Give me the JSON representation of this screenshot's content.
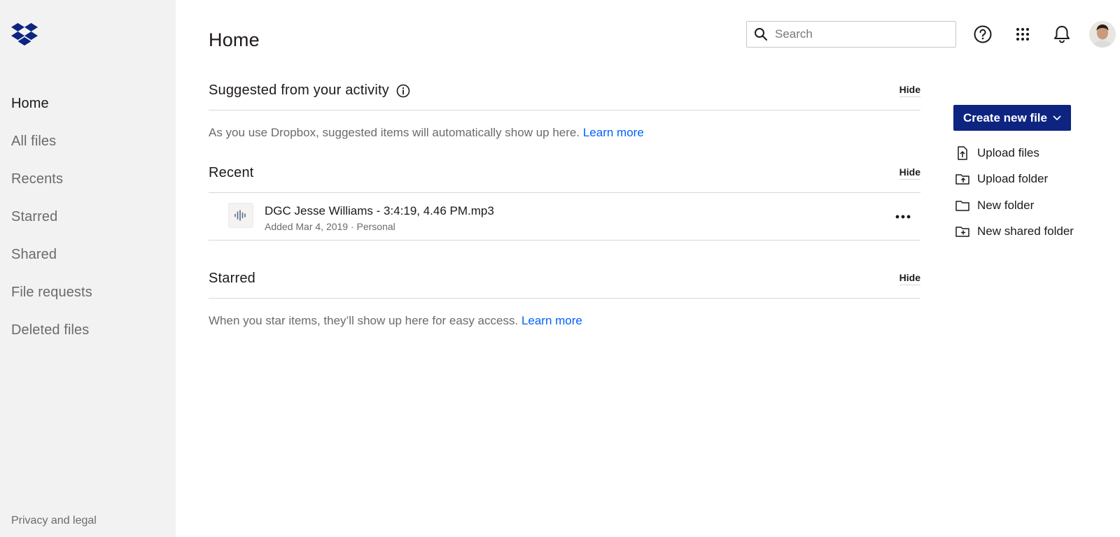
{
  "app": {
    "brand": "Dropbox",
    "brand_color": "#0d2481",
    "link_color": "#0061fe"
  },
  "sidebar": {
    "items": [
      {
        "label": "Home",
        "active": true
      },
      {
        "label": "All files",
        "active": false
      },
      {
        "label": "Recents",
        "active": false
      },
      {
        "label": "Starred",
        "active": false
      },
      {
        "label": "Shared",
        "active": false
      },
      {
        "label": "File requests",
        "active": false
      },
      {
        "label": "Deleted files",
        "active": false
      }
    ],
    "footer_link": "Privacy and legal"
  },
  "header": {
    "title": "Home",
    "search_placeholder": "Search",
    "icons": [
      "help-icon",
      "app-grid-icon",
      "bell-icon"
    ]
  },
  "suggested": {
    "title": "Suggested from your activity",
    "hide_label": "Hide",
    "empty_text": "As you use Dropbox, suggested items will automatically show up here.",
    "learn_more": "Learn more"
  },
  "recent": {
    "title": "Recent",
    "hide_label": "Hide",
    "files": [
      {
        "name": "DGC Jesse Williams - 3:4:19, 4.46 PM.mp3",
        "meta": "Added Mar 4, 2019 · Personal",
        "icon": "audio-file-icon"
      }
    ]
  },
  "starred": {
    "title": "Starred",
    "hide_label": "Hide",
    "empty_text": "When you star items, they’ll show up here for easy access.",
    "learn_more": "Learn more"
  },
  "actions": {
    "create_label": "Create new file",
    "items": [
      {
        "label": "Upload files",
        "icon": "upload-file-icon"
      },
      {
        "label": "Upload folder",
        "icon": "upload-folder-icon"
      },
      {
        "label": "New folder",
        "icon": "folder-icon"
      },
      {
        "label": "New shared folder",
        "icon": "shared-folder-icon"
      }
    ]
  }
}
